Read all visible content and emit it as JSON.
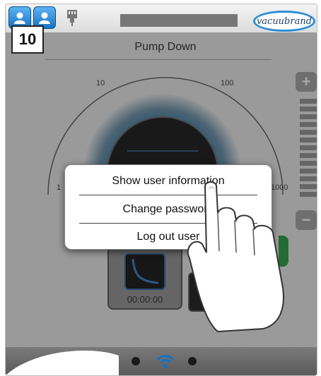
{
  "header": {
    "step_number": "10",
    "logo_text": "vacuubrand",
    "page_title": "Pump Down"
  },
  "gauge": {
    "scale_labels": [
      "10",
      "100",
      "1",
      "1000"
    ]
  },
  "side_controls": {
    "plus_label": "+",
    "minus_label": "−"
  },
  "tile": {
    "timer": "00:00:00"
  },
  "user_menu": {
    "items": [
      {
        "label": "Show user information"
      },
      {
        "label": "Change password"
      },
      {
        "label": "Log out user"
      }
    ]
  },
  "colors": {
    "accent": "#1673c4",
    "gauge_glow": "#0d6aa8",
    "status_green": "#1d9a3a"
  },
  "icons": [
    "user-icon",
    "admin-user-icon",
    "network-port-icon",
    "finger-pointer-icon",
    "vacuum-pump-icon"
  ]
}
